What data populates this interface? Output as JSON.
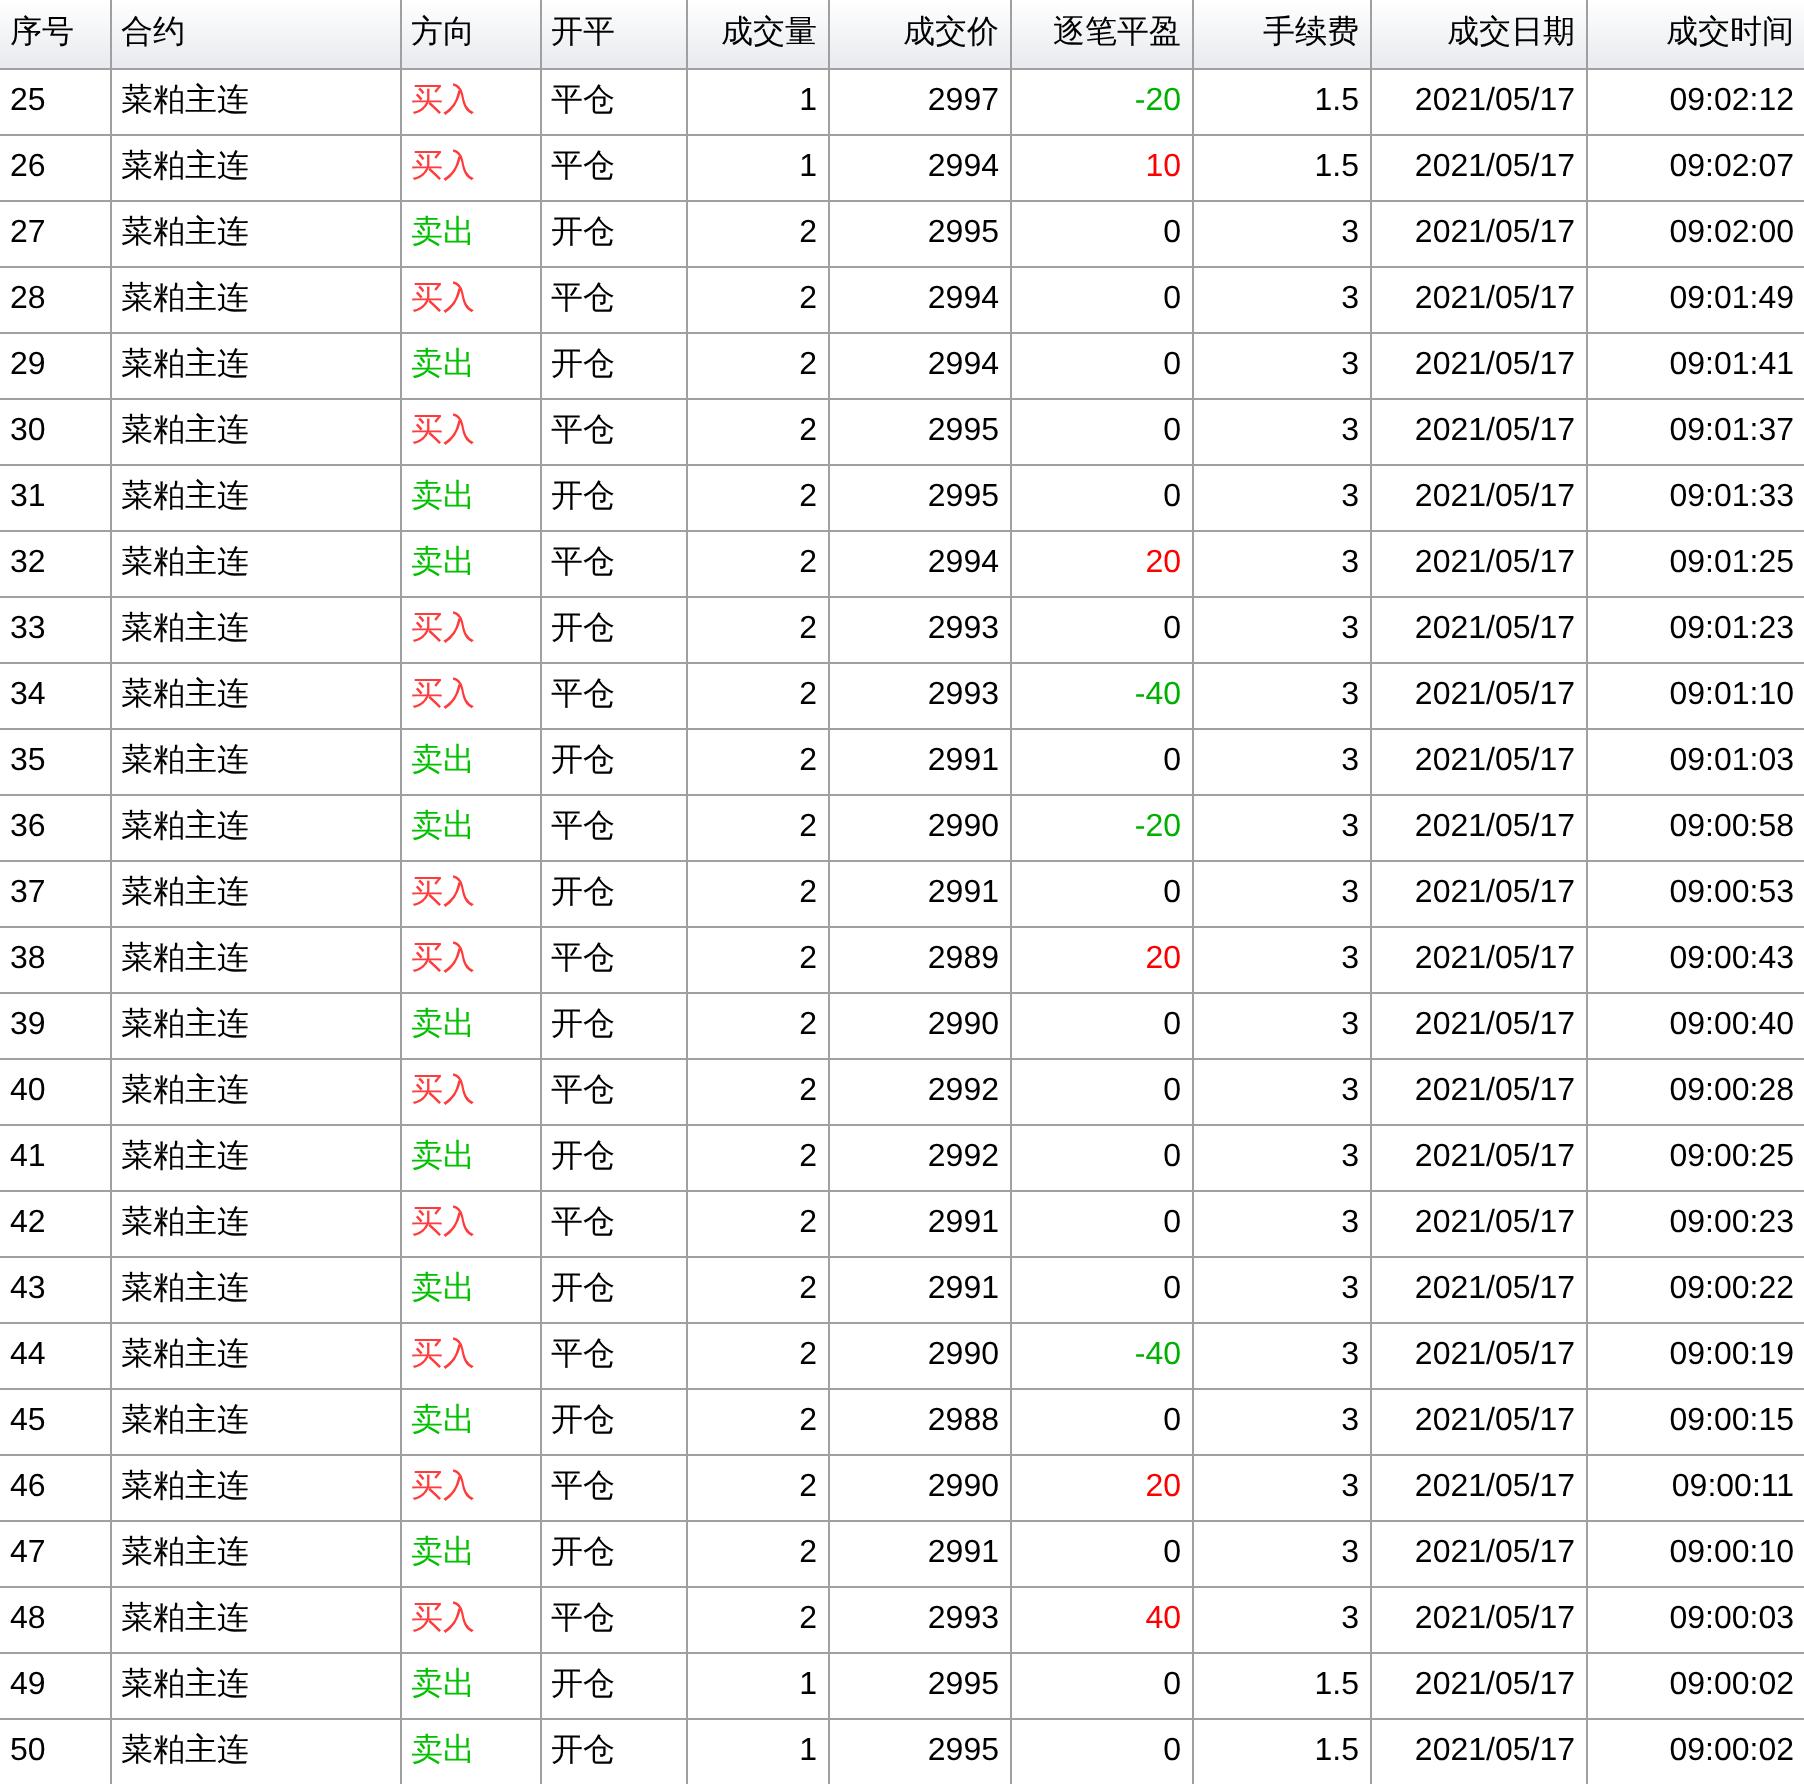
{
  "table": {
    "columns": [
      "序号",
      "合约",
      "方向",
      "开平",
      "成交量",
      "成交价",
      "逐笔平盈",
      "手续费",
      "成交日期",
      "成交时间"
    ],
    "rows": [
      {
        "no": "25",
        "contract": "菜粕主连",
        "direction": {
          "text": "买入",
          "color": "#ff3b3b"
        },
        "open_close": "平仓",
        "volume": "1",
        "price": "2997",
        "pnl": {
          "text": "-20",
          "color": "#00b000"
        },
        "fee": "1.5",
        "date": "2021/05/17",
        "time": "09:02:12"
      },
      {
        "no": "26",
        "contract": "菜粕主连",
        "direction": {
          "text": "买入",
          "color": "#ff3b3b"
        },
        "open_close": "平仓",
        "volume": "1",
        "price": "2994",
        "pnl": {
          "text": "10",
          "color": "#ff0000"
        },
        "fee": "1.5",
        "date": "2021/05/17",
        "time": "09:02:07"
      },
      {
        "no": "27",
        "contract": "菜粕主连",
        "direction": {
          "text": "卖出",
          "color": "#00c000"
        },
        "open_close": "开仓",
        "volume": "2",
        "price": "2995",
        "pnl": {
          "text": "0",
          "color": "#000000"
        },
        "fee": "3",
        "date": "2021/05/17",
        "time": "09:02:00"
      },
      {
        "no": "28",
        "contract": "菜粕主连",
        "direction": {
          "text": "买入",
          "color": "#ff3b3b"
        },
        "open_close": "平仓",
        "volume": "2",
        "price": "2994",
        "pnl": {
          "text": "0",
          "color": "#000000"
        },
        "fee": "3",
        "date": "2021/05/17",
        "time": "09:01:49"
      },
      {
        "no": "29",
        "contract": "菜粕主连",
        "direction": {
          "text": "卖出",
          "color": "#00c000"
        },
        "open_close": "开仓",
        "volume": "2",
        "price": "2994",
        "pnl": {
          "text": "0",
          "color": "#000000"
        },
        "fee": "3",
        "date": "2021/05/17",
        "time": "09:01:41"
      },
      {
        "no": "30",
        "contract": "菜粕主连",
        "direction": {
          "text": "买入",
          "color": "#ff3b3b"
        },
        "open_close": "平仓",
        "volume": "2",
        "price": "2995",
        "pnl": {
          "text": "0",
          "color": "#000000"
        },
        "fee": "3",
        "date": "2021/05/17",
        "time": "09:01:37"
      },
      {
        "no": "31",
        "contract": "菜粕主连",
        "direction": {
          "text": "卖出",
          "color": "#00c000"
        },
        "open_close": "开仓",
        "volume": "2",
        "price": "2995",
        "pnl": {
          "text": "0",
          "color": "#000000"
        },
        "fee": "3",
        "date": "2021/05/17",
        "time": "09:01:33"
      },
      {
        "no": "32",
        "contract": "菜粕主连",
        "direction": {
          "text": "卖出",
          "color": "#00c000"
        },
        "open_close": "平仓",
        "volume": "2",
        "price": "2994",
        "pnl": {
          "text": "20",
          "color": "#ff0000"
        },
        "fee": "3",
        "date": "2021/05/17",
        "time": "09:01:25"
      },
      {
        "no": "33",
        "contract": "菜粕主连",
        "direction": {
          "text": "买入",
          "color": "#ff3b3b"
        },
        "open_close": "开仓",
        "volume": "2",
        "price": "2993",
        "pnl": {
          "text": "0",
          "color": "#000000"
        },
        "fee": "3",
        "date": "2021/05/17",
        "time": "09:01:23"
      },
      {
        "no": "34",
        "contract": "菜粕主连",
        "direction": {
          "text": "买入",
          "color": "#ff3b3b"
        },
        "open_close": "平仓",
        "volume": "2",
        "price": "2993",
        "pnl": {
          "text": "-40",
          "color": "#00b000"
        },
        "fee": "3",
        "date": "2021/05/17",
        "time": "09:01:10"
      },
      {
        "no": "35",
        "contract": "菜粕主连",
        "direction": {
          "text": "卖出",
          "color": "#00c000"
        },
        "open_close": "开仓",
        "volume": "2",
        "price": "2991",
        "pnl": {
          "text": "0",
          "color": "#000000"
        },
        "fee": "3",
        "date": "2021/05/17",
        "time": "09:01:03"
      },
      {
        "no": "36",
        "contract": "菜粕主连",
        "direction": {
          "text": "卖出",
          "color": "#00c000"
        },
        "open_close": "平仓",
        "volume": "2",
        "price": "2990",
        "pnl": {
          "text": "-20",
          "color": "#00b000"
        },
        "fee": "3",
        "date": "2021/05/17",
        "time": "09:00:58"
      },
      {
        "no": "37",
        "contract": "菜粕主连",
        "direction": {
          "text": "买入",
          "color": "#ff3b3b"
        },
        "open_close": "开仓",
        "volume": "2",
        "price": "2991",
        "pnl": {
          "text": "0",
          "color": "#000000"
        },
        "fee": "3",
        "date": "2021/05/17",
        "time": "09:00:53"
      },
      {
        "no": "38",
        "contract": "菜粕主连",
        "direction": {
          "text": "买入",
          "color": "#ff3b3b"
        },
        "open_close": "平仓",
        "volume": "2",
        "price": "2989",
        "pnl": {
          "text": "20",
          "color": "#ff0000"
        },
        "fee": "3",
        "date": "2021/05/17",
        "time": "09:00:43"
      },
      {
        "no": "39",
        "contract": "菜粕主连",
        "direction": {
          "text": "卖出",
          "color": "#00c000"
        },
        "open_close": "开仓",
        "volume": "2",
        "price": "2990",
        "pnl": {
          "text": "0",
          "color": "#000000"
        },
        "fee": "3",
        "date": "2021/05/17",
        "time": "09:00:40"
      },
      {
        "no": "40",
        "contract": "菜粕主连",
        "direction": {
          "text": "买入",
          "color": "#ff3b3b"
        },
        "open_close": "平仓",
        "volume": "2",
        "price": "2992",
        "pnl": {
          "text": "0",
          "color": "#000000"
        },
        "fee": "3",
        "date": "2021/05/17",
        "time": "09:00:28"
      },
      {
        "no": "41",
        "contract": "菜粕主连",
        "direction": {
          "text": "卖出",
          "color": "#00c000"
        },
        "open_close": "开仓",
        "volume": "2",
        "price": "2992",
        "pnl": {
          "text": "0",
          "color": "#000000"
        },
        "fee": "3",
        "date": "2021/05/17",
        "time": "09:00:25"
      },
      {
        "no": "42",
        "contract": "菜粕主连",
        "direction": {
          "text": "买入",
          "color": "#ff3b3b"
        },
        "open_close": "平仓",
        "volume": "2",
        "price": "2991",
        "pnl": {
          "text": "0",
          "color": "#000000"
        },
        "fee": "3",
        "date": "2021/05/17",
        "time": "09:00:23"
      },
      {
        "no": "43",
        "contract": "菜粕主连",
        "direction": {
          "text": "卖出",
          "color": "#00c000"
        },
        "open_close": "开仓",
        "volume": "2",
        "price": "2991",
        "pnl": {
          "text": "0",
          "color": "#000000"
        },
        "fee": "3",
        "date": "2021/05/17",
        "time": "09:00:22"
      },
      {
        "no": "44",
        "contract": "菜粕主连",
        "direction": {
          "text": "买入",
          "color": "#ff3b3b"
        },
        "open_close": "平仓",
        "volume": "2",
        "price": "2990",
        "pnl": {
          "text": "-40",
          "color": "#00b000"
        },
        "fee": "3",
        "date": "2021/05/17",
        "time": "09:00:19"
      },
      {
        "no": "45",
        "contract": "菜粕主连",
        "direction": {
          "text": "卖出",
          "color": "#00c000"
        },
        "open_close": "开仓",
        "volume": "2",
        "price": "2988",
        "pnl": {
          "text": "0",
          "color": "#000000"
        },
        "fee": "3",
        "date": "2021/05/17",
        "time": "09:00:15"
      },
      {
        "no": "46",
        "contract": "菜粕主连",
        "direction": {
          "text": "买入",
          "color": "#ff3b3b"
        },
        "open_close": "平仓",
        "volume": "2",
        "price": "2990",
        "pnl": {
          "text": "20",
          "color": "#ff0000"
        },
        "fee": "3",
        "date": "2021/05/17",
        "time": "09:00:11"
      },
      {
        "no": "47",
        "contract": "菜粕主连",
        "direction": {
          "text": "卖出",
          "color": "#00c000"
        },
        "open_close": "开仓",
        "volume": "2",
        "price": "2991",
        "pnl": {
          "text": "0",
          "color": "#000000"
        },
        "fee": "3",
        "date": "2021/05/17",
        "time": "09:00:10"
      },
      {
        "no": "48",
        "contract": "菜粕主连",
        "direction": {
          "text": "买入",
          "color": "#ff3b3b"
        },
        "open_close": "平仓",
        "volume": "2",
        "price": "2993",
        "pnl": {
          "text": "40",
          "color": "#ff0000"
        },
        "fee": "3",
        "date": "2021/05/17",
        "time": "09:00:03"
      },
      {
        "no": "49",
        "contract": "菜粕主连",
        "direction": {
          "text": "卖出",
          "color": "#00c000"
        },
        "open_close": "开仓",
        "volume": "1",
        "price": "2995",
        "pnl": {
          "text": "0",
          "color": "#000000"
        },
        "fee": "1.5",
        "date": "2021/05/17",
        "time": "09:00:02"
      },
      {
        "no": "50",
        "contract": "菜粕主连",
        "direction": {
          "text": "卖出",
          "color": "#00c000"
        },
        "open_close": "开仓",
        "volume": "1",
        "price": "2995",
        "pnl": {
          "text": "0",
          "color": "#000000"
        },
        "fee": "1.5",
        "date": "2021/05/17",
        "time": "09:00:02"
      }
    ]
  }
}
